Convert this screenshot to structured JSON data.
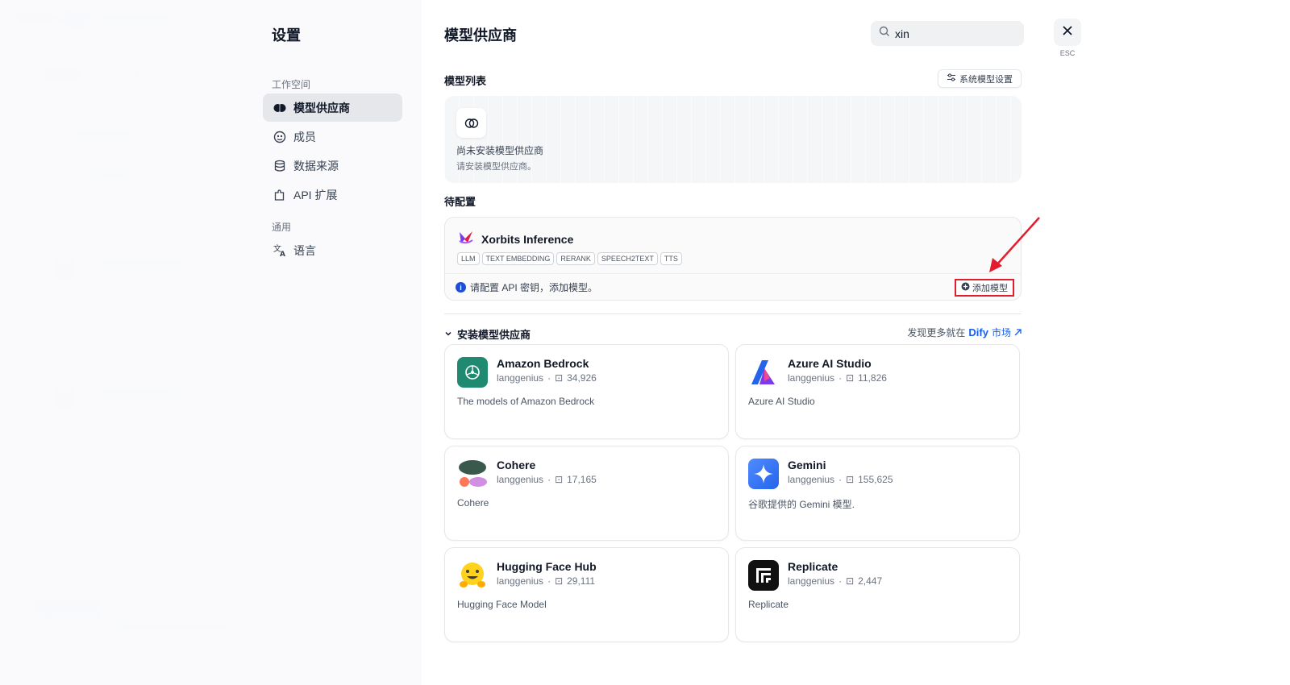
{
  "settings": {
    "title": "设置",
    "group_workspace": "工作空间",
    "group_general": "通用",
    "items": [
      {
        "label": "模型供应商",
        "icon": "brain-icon"
      },
      {
        "label": "成员",
        "icon": "members-icon"
      },
      {
        "label": "数据来源",
        "icon": "database-icon"
      },
      {
        "label": "API 扩展",
        "icon": "puzzle-icon"
      },
      {
        "label": "语言",
        "icon": "translate-icon"
      }
    ]
  },
  "main": {
    "title": "模型供应商",
    "search_value": "xin",
    "esc_label": "ESC",
    "model_list": {
      "title": "模型列表",
      "system_settings_button": "系统模型设置",
      "empty_title": "尚未安装模型供应商",
      "empty_desc": "请安装模型供应商。"
    },
    "pending": {
      "title": "待配置",
      "provider_name": "Xorbits Inference",
      "tags": [
        "LLM",
        "TEXT EMBEDDING",
        "RERANK",
        "SPEECH2TEXT",
        "TTS"
      ],
      "hint": "请配置 API 密钥，添加模型。",
      "add_model_button": "添加模型"
    },
    "install": {
      "title": "安装模型供应商",
      "market_text": "发现更多就在",
      "market_brand": "Dify",
      "market_suffix": "市场",
      "providers": [
        {
          "name": "Amazon Bedrock",
          "author": "langgenius",
          "installs": "34,926",
          "desc": "The models of Amazon Bedrock"
        },
        {
          "name": "Azure AI Studio",
          "author": "langgenius",
          "installs": "11,826",
          "desc": "Azure AI Studio"
        },
        {
          "name": "Cohere",
          "author": "langgenius",
          "installs": "17,165",
          "desc": "Cohere"
        },
        {
          "name": "Gemini",
          "author": "langgenius",
          "installs": "155,625",
          "desc": "谷歌提供的 Gemini 模型."
        },
        {
          "name": "Hugging Face Hub",
          "author": "langgenius",
          "installs": "29,111",
          "desc": "Hugging Face Model"
        },
        {
          "name": "Replicate",
          "author": "langgenius",
          "installs": "2,447",
          "desc": "Replicate"
        }
      ]
    }
  },
  "colors": {
    "accent": "#155eef",
    "highlight_red": "#e11d2e"
  }
}
